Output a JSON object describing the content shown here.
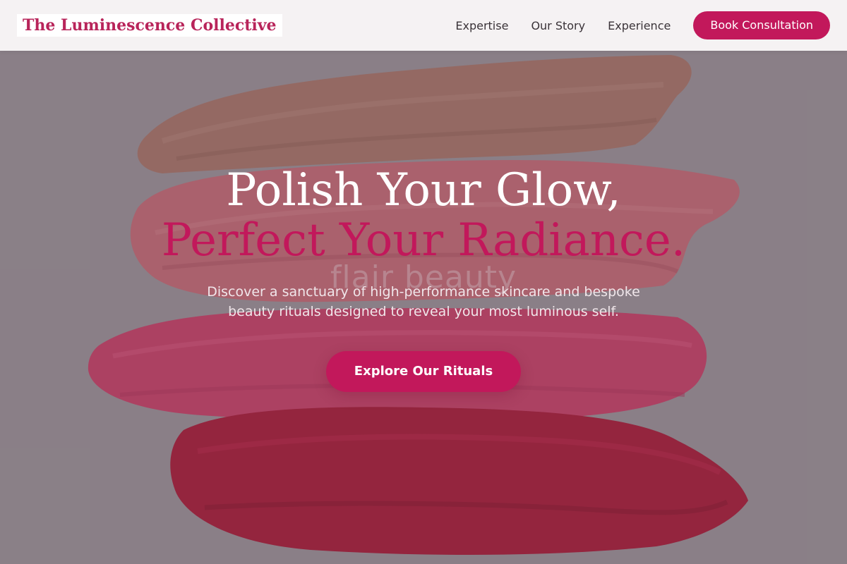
{
  "brand": {
    "name": "The Luminescence Collective"
  },
  "nav": {
    "links": [
      {
        "label": "Expertise"
      },
      {
        "label": "Our Story"
      },
      {
        "label": "Experience"
      }
    ],
    "cta_label": "Book Consultation"
  },
  "hero": {
    "headline_line1": "Polish Your Glow,",
    "headline_line2": "Perfect Your Radiance.",
    "subheading": "Discover a sanctuary of high-performance skincare and bespoke beauty rituals designed to reveal your most luminous self.",
    "cta_label": "Explore Our Rituals",
    "watermark_text": "flair beauty"
  },
  "colors": {
    "accent": "#c2185b",
    "brand_text": "#b8245a",
    "background": "#8c8088",
    "stroke_tan": "#9a6a60",
    "stroke_rose": "#b45a68",
    "stroke_pink": "#b83a5e",
    "stroke_red": "#9c1732"
  },
  "icons": {
    "background_image": "paint-strokes-image"
  }
}
